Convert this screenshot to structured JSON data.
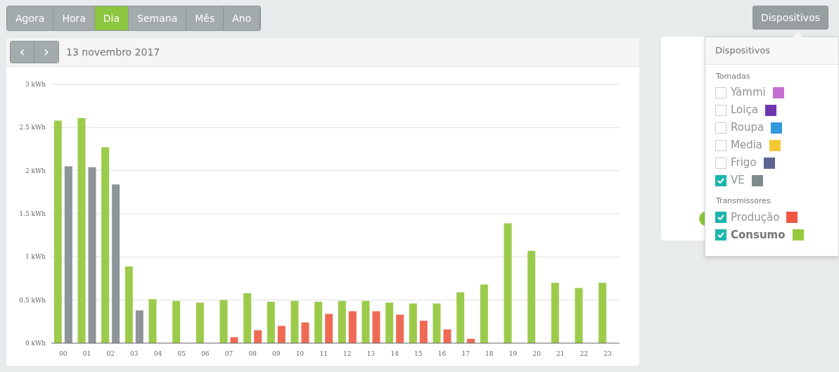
{
  "period_tabs": [
    {
      "label": "Agora",
      "selected": false
    },
    {
      "label": "Hora",
      "selected": false
    },
    {
      "label": "Dia",
      "selected": true
    },
    {
      "label": "Semana",
      "selected": false
    },
    {
      "label": "Mês",
      "selected": false
    },
    {
      "label": "Ano",
      "selected": false
    }
  ],
  "devices_button": {
    "label": "Dispositivos",
    "expanded": true
  },
  "chart_card": {
    "prev": "‹",
    "next": "›",
    "date": "13 novembro 2017",
    "chart_data": {
      "type": "bar",
      "grid": true,
      "categories": [
        "00",
        "01",
        "02",
        "03",
        "04",
        "05",
        "06",
        "07",
        "08",
        "09",
        "10",
        "11",
        "12",
        "13",
        "14",
        "15",
        "16",
        "17",
        "18",
        "19",
        "20",
        "21",
        "22",
        "23"
      ],
      "ylim": [
        0,
        3
      ],
      "yticks": [
        {
          "value": 0,
          "label": "0 kWh"
        },
        {
          "value": 0.5,
          "label": "0.5 kWh"
        },
        {
          "value": 1,
          "label": "1 kWh"
        },
        {
          "value": 1.5,
          "label": "1.5 kWh"
        },
        {
          "value": 2,
          "label": "2 kWh"
        },
        {
          "value": 2.5,
          "label": "2.5 kWh"
        },
        {
          "value": 3,
          "label": "3 kWh"
        }
      ],
      "series": [
        {
          "color": "#9ccb4b",
          "values": [
            2.58,
            2.61,
            2.27,
            0.89,
            0.51,
            0.49,
            0.47,
            0.5,
            0.58,
            0.48,
            0.49,
            0.48,
            0.49,
            0.49,
            0.47,
            0.46,
            0.46,
            0.59,
            0.68,
            1.39,
            1.07,
            0.7,
            0.64,
            0.7
          ]
        },
        {
          "color": "#8c9599",
          "values": [
            2.05,
            2.04,
            1.84,
            0.38,
            null,
            null,
            null,
            null,
            null,
            null,
            null,
            null,
            null,
            null,
            null,
            null,
            null,
            null,
            null,
            null,
            null,
            null,
            null,
            null
          ]
        },
        {
          "color": "#ef6a55",
          "values": [
            null,
            null,
            null,
            null,
            null,
            null,
            null,
            0.07,
            0.15,
            0.2,
            0.24,
            0.34,
            0.37,
            0.37,
            0.33,
            0.26,
            0.16,
            0.05,
            null,
            null,
            null,
            null,
            null,
            null
          ]
        }
      ]
    }
  },
  "devices_menu": {
    "title": "Dispositivos",
    "groups": [
      {
        "label": "Tomadas",
        "items": [
          {
            "label": "Yämmi",
            "color": "#c76fd0",
            "checked": false,
            "emphasized": false
          },
          {
            "label": "Loiça",
            "color": "#6f36b0",
            "checked": false,
            "emphasized": false
          },
          {
            "label": "Roupa",
            "color": "#3399dd",
            "checked": false,
            "emphasized": false
          },
          {
            "label": "Media",
            "color": "#f2c935",
            "checked": false,
            "emphasized": false
          },
          {
            "label": "Frigo",
            "color": "#5d6590",
            "checked": false,
            "emphasized": false
          },
          {
            "label": "VE",
            "color": "#7f8a8c",
            "checked": true,
            "emphasized": false
          }
        ]
      },
      {
        "label": "Transmissores",
        "items": [
          {
            "label": "Produção",
            "color": "#ef5644",
            "checked": true,
            "emphasized": false
          },
          {
            "label": "Consumo",
            "color": "#97c940",
            "checked": true,
            "emphasized": true
          }
        ]
      }
    ]
  }
}
